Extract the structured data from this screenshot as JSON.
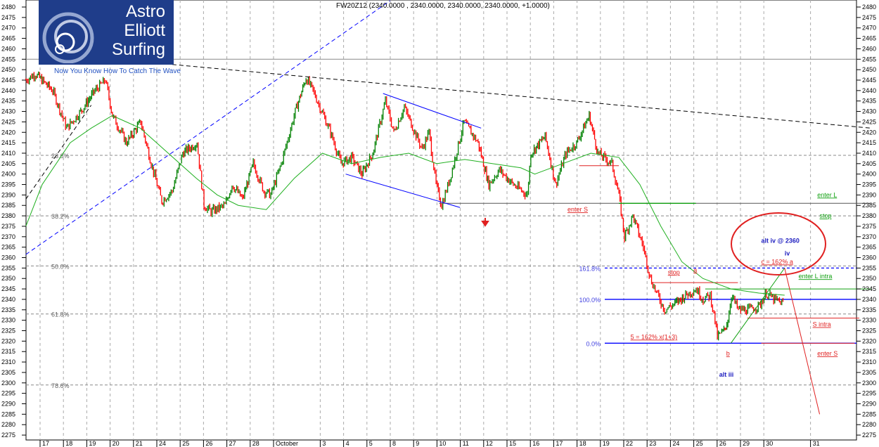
{
  "chart_data": {
    "type": "line",
    "title": "FW20Z12 (2340.0000 , 2340.0000, 2340.0000, 2340.0000, +1.0000)",
    "ylim": [
      2275,
      2480
    ],
    "ytick_step": 5,
    "x_unit": "trading day index (0 = 17 Sep)",
    "x_labels": [
      {
        "i": 0,
        "label": "17"
      },
      {
        "i": 1,
        "label": "18"
      },
      {
        "i": 2,
        "label": "19"
      },
      {
        "i": 3,
        "label": "20"
      },
      {
        "i": 4,
        "label": "21"
      },
      {
        "i": 5,
        "label": "24"
      },
      {
        "i": 6,
        "label": "25"
      },
      {
        "i": 7,
        "label": "26"
      },
      {
        "i": 8,
        "label": "27"
      },
      {
        "i": 9,
        "label": "28"
      },
      {
        "i": 10,
        "label": "October"
      },
      {
        "i": 12,
        "label": "3"
      },
      {
        "i": 13,
        "label": "4"
      },
      {
        "i": 14,
        "label": "5"
      },
      {
        "i": 15,
        "label": "8"
      },
      {
        "i": 16,
        "label": "9"
      },
      {
        "i": 17,
        "label": "10"
      },
      {
        "i": 18,
        "label": "11"
      },
      {
        "i": 19,
        "label": "12"
      },
      {
        "i": 20,
        "label": "15"
      },
      {
        "i": 21,
        "label": "16"
      },
      {
        "i": 22,
        "label": "17"
      },
      {
        "i": 23,
        "label": "18"
      },
      {
        "i": 24,
        "label": "19"
      },
      {
        "i": 25,
        "label": "22"
      },
      {
        "i": 26,
        "label": "23"
      },
      {
        "i": 27,
        "label": "24"
      },
      {
        "i": 28,
        "label": "25"
      },
      {
        "i": 29,
        "label": "26"
      },
      {
        "i": 30,
        "label": "29"
      },
      {
        "i": 31,
        "label": "30"
      },
      {
        "i": 33,
        "label": "31"
      }
    ],
    "price_path": [
      [
        -0.7,
        2445
      ],
      [
        -0.3,
        2448
      ],
      [
        0.45,
        2440
      ],
      [
        1.05,
        2422
      ],
      [
        1.65,
        2430
      ],
      [
        2.26,
        2440
      ],
      [
        2.71,
        2445
      ],
      [
        3.01,
        2428
      ],
      [
        3.61,
        2415
      ],
      [
        4.22,
        2425
      ],
      [
        4.67,
        2405
      ],
      [
        5.12,
        2387
      ],
      [
        5.57,
        2392
      ],
      [
        6.02,
        2410
      ],
      [
        6.63,
        2415
      ],
      [
        6.93,
        2385
      ],
      [
        7.23,
        2382
      ],
      [
        7.83,
        2385
      ],
      [
        8.13,
        2395
      ],
      [
        8.58,
        2388
      ],
      [
        9.04,
        2405
      ],
      [
        9.49,
        2392
      ],
      [
        9.79,
        2390
      ],
      [
        10.24,
        2405
      ],
      [
        10.84,
        2430
      ],
      [
        11.3,
        2446
      ],
      [
        11.6,
        2440
      ],
      [
        11.9,
        2432
      ],
      [
        12.35,
        2420
      ],
      [
        12.8,
        2405
      ],
      [
        13.25,
        2408
      ],
      [
        13.7,
        2400
      ],
      [
        14.16,
        2410
      ],
      [
        14.7,
        2435
      ],
      [
        15.06,
        2420
      ],
      [
        15.51,
        2432
      ],
      [
        15.96,
        2420
      ],
      [
        16.27,
        2412
      ],
      [
        16.57,
        2420
      ],
      [
        16.87,
        2395
      ],
      [
        17.11,
        2385
      ],
      [
        17.47,
        2398
      ],
      [
        18.07,
        2425
      ],
      [
        18.67,
        2415
      ],
      [
        19.13,
        2395
      ],
      [
        19.58,
        2402
      ],
      [
        20.18,
        2395
      ],
      [
        20.78,
        2390
      ],
      [
        20.93,
        2410
      ],
      [
        21.54,
        2418
      ],
      [
        21.99,
        2395
      ],
      [
        22.44,
        2410
      ],
      [
        22.89,
        2415
      ],
      [
        23.43,
        2428
      ],
      [
        23.8,
        2410
      ],
      [
        24.4,
        2405
      ],
      [
        24.7,
        2390
      ],
      [
        24.94,
        2370
      ],
      [
        25.3,
        2380
      ],
      [
        25.75,
        2365
      ],
      [
        26.05,
        2350
      ],
      [
        26.36,
        2342
      ],
      [
        26.66,
        2335
      ],
      [
        27.1,
        2338
      ],
      [
        27.56,
        2342
      ],
      [
        28.01,
        2345
      ],
      [
        28.31,
        2340
      ],
      [
        28.61,
        2342
      ],
      [
        28.77,
        2333
      ],
      [
        28.92,
        2322
      ],
      [
        29.2,
        2325
      ],
      [
        29.37,
        2330
      ],
      [
        29.52,
        2342
      ],
      [
        29.82,
        2335
      ],
      [
        30.27,
        2335
      ],
      [
        30.72,
        2337
      ],
      [
        31.02,
        2343
      ],
      [
        31.33,
        2340
      ],
      [
        31.78,
        2338
      ]
    ],
    "moving_average": [
      [
        -0.7,
        2375
      ],
      [
        0,
        2395
      ],
      [
        1.2,
        2415
      ],
      [
        2.1,
        2422
      ],
      [
        3.0,
        2428
      ],
      [
        4.2,
        2422
      ],
      [
        5.4,
        2410
      ],
      [
        6.6,
        2398
      ],
      [
        7.5,
        2390
      ],
      [
        8.4,
        2385
      ],
      [
        9.6,
        2383
      ],
      [
        10.8,
        2398
      ],
      [
        12.0,
        2410
      ],
      [
        13.25,
        2405
      ],
      [
        14.5,
        2408
      ],
      [
        15.7,
        2410
      ],
      [
        16.9,
        2405
      ],
      [
        18.1,
        2407
      ],
      [
        19.3,
        2405
      ],
      [
        20.5,
        2403
      ],
      [
        21.1,
        2400
      ],
      [
        22.3,
        2405
      ],
      [
        23.5,
        2410
      ],
      [
        24.7,
        2408
      ],
      [
        25.6,
        2395
      ],
      [
        26.5,
        2375
      ],
      [
        27.4,
        2358
      ],
      [
        28.3,
        2350
      ],
      [
        29.5,
        2345
      ],
      [
        30.7,
        2343
      ],
      [
        31.8,
        2342
      ]
    ],
    "fib_retracements": [
      {
        "label": "23.6%",
        "price": 2409
      },
      {
        "label": "38.2%",
        "price": 2380
      },
      {
        "label": "50.0%",
        "price": 2356
      },
      {
        "label": "61.8%",
        "price": 2333
      },
      {
        "label": "78.6%",
        "price": 2299
      }
    ],
    "fib_extensions": [
      {
        "label": "161.8%",
        "price": 2355,
        "style": "dashed"
      },
      {
        "label": "100.0%",
        "price": 2340,
        "style": "solid"
      },
      {
        "label": "0.0%",
        "price": 2319,
        "style": "solid"
      }
    ],
    "resistance_level": 2455,
    "annotations": [
      {
        "text": "enter S",
        "color": "#e02020",
        "i": 22.5,
        "price": 2382
      },
      {
        "text": "enter L",
        "color": "#10a010",
        "i": 33.2,
        "price": 2389
      },
      {
        "text": "stop",
        "color": "#10a010",
        "i": 33.3,
        "price": 2379
      },
      {
        "text": "stop",
        "color": "#e02020",
        "i": 26.8,
        "price": 2352
      },
      {
        "text": "a",
        "color": "#e02020",
        "i": 27.9,
        "price": 2353
      },
      {
        "text": "enter L intra",
        "color": "#10a010",
        "i": 32.4,
        "price": 2350
      },
      {
        "text": "c = 162% a",
        "color": "#e02020",
        "i": 30.8,
        "price": 2357
      },
      {
        "text": "alt iv @ 2360",
        "color": "#2020c0",
        "i": 30.8,
        "price": 2367
      },
      {
        "text": "iv",
        "color": "#2020c0",
        "i": 31.8,
        "price": 2361
      },
      {
        "text": "S intra",
        "color": "#e02020",
        "i": 33.0,
        "price": 2327
      },
      {
        "text": "enter S",
        "color": "#e02020",
        "i": 33.2,
        "price": 2313
      },
      {
        "text": "5 = 162% x(1+3)",
        "color": "#e02020",
        "i": 25.2,
        "price": 2321
      },
      {
        "text": "b",
        "color": "#e02020",
        "i": 29.3,
        "price": 2313
      },
      {
        "text": "alt iii",
        "color": "#2020c0",
        "i": 29.0,
        "price": 2303
      }
    ]
  },
  "logo": {
    "line1": "Astro",
    "line2": "Elliott",
    "line3": "Surfing",
    "tagline": "Now You Know How To Catch The Wave"
  }
}
